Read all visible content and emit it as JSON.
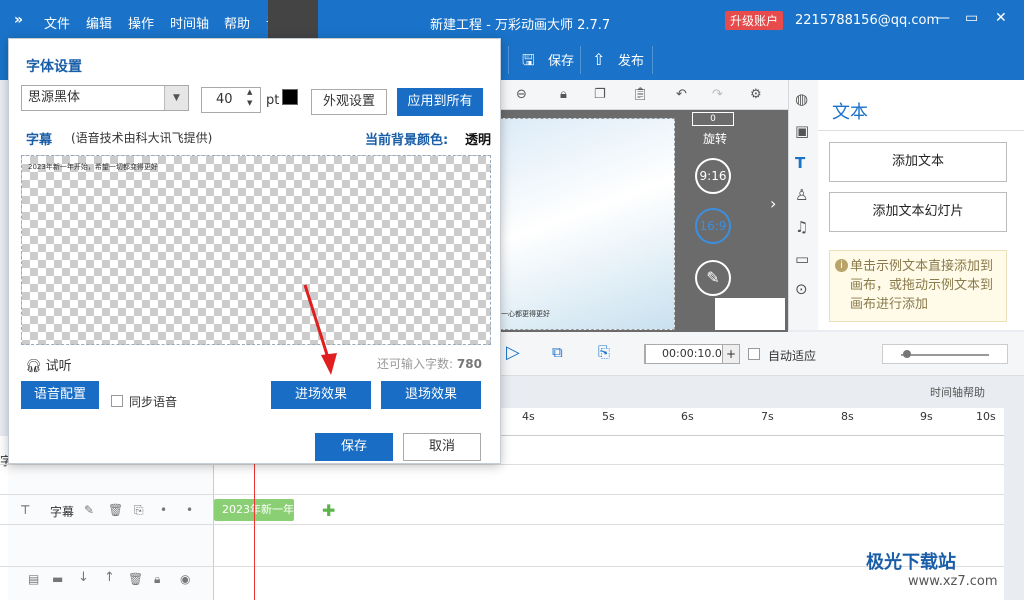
{
  "titlebar": {
    "logo": "»",
    "menus": [
      "文件",
      "编辑",
      "操作",
      "时间轴",
      "帮助",
      "设置"
    ],
    "title": "新建工程 - 万彩动画大师 2.7.7",
    "upgrade": "升级账户",
    "account": "2215788156@qq.com",
    "win": [
      "—",
      "▭",
      "✕"
    ]
  },
  "toolbar": {
    "save": "保存",
    "publish": "发布"
  },
  "stage": {
    "rotate_value": "0",
    "rotate_label": "旋转",
    "ratio1": "9:16",
    "ratio2": "16:9",
    "slide_caption": "一心都更得更好"
  },
  "text_panel": {
    "title": "文本",
    "add_text": "添加文本",
    "add_slides": "添加文本幻灯片",
    "hint": "单击示例文本直接添加到画布，或拖动示例文本到画布进行添加"
  },
  "playbar": {
    "time": "00:00:10.0",
    "auto_fit": "自动适应",
    "help": "时间轴帮助"
  },
  "ruler": [
    "4s",
    "5s",
    "6s",
    "7s",
    "8s",
    "9s",
    "10s"
  ],
  "track": {
    "label": "字幕",
    "clip": "2023年新一年",
    "left_char": "字"
  },
  "dialog": {
    "title": "字体设置",
    "font": "思源黑体",
    "size": "40",
    "unit": "pt",
    "appearance": "外观设置",
    "apply_all": "应用到所有",
    "subtitle_label": "字幕",
    "subtitle_note": "(语音技术由科大讯飞提供)",
    "bg_color_label": "当前背景颜色:",
    "bg_color_value": "透明",
    "preview_text": "2023年新一年开始，希望一切都变得更好",
    "listen": "试听",
    "remain_label": "还可输入字数:",
    "remain_value": "780",
    "voice_config": "语音配置",
    "sync_voice": "同步语音",
    "enter_effect": "进场效果",
    "exit_effect": "退场效果",
    "save": "保存",
    "cancel": "取消"
  },
  "watermark": {
    "brand": "极光下载站",
    "url": "www.xz7.com"
  }
}
